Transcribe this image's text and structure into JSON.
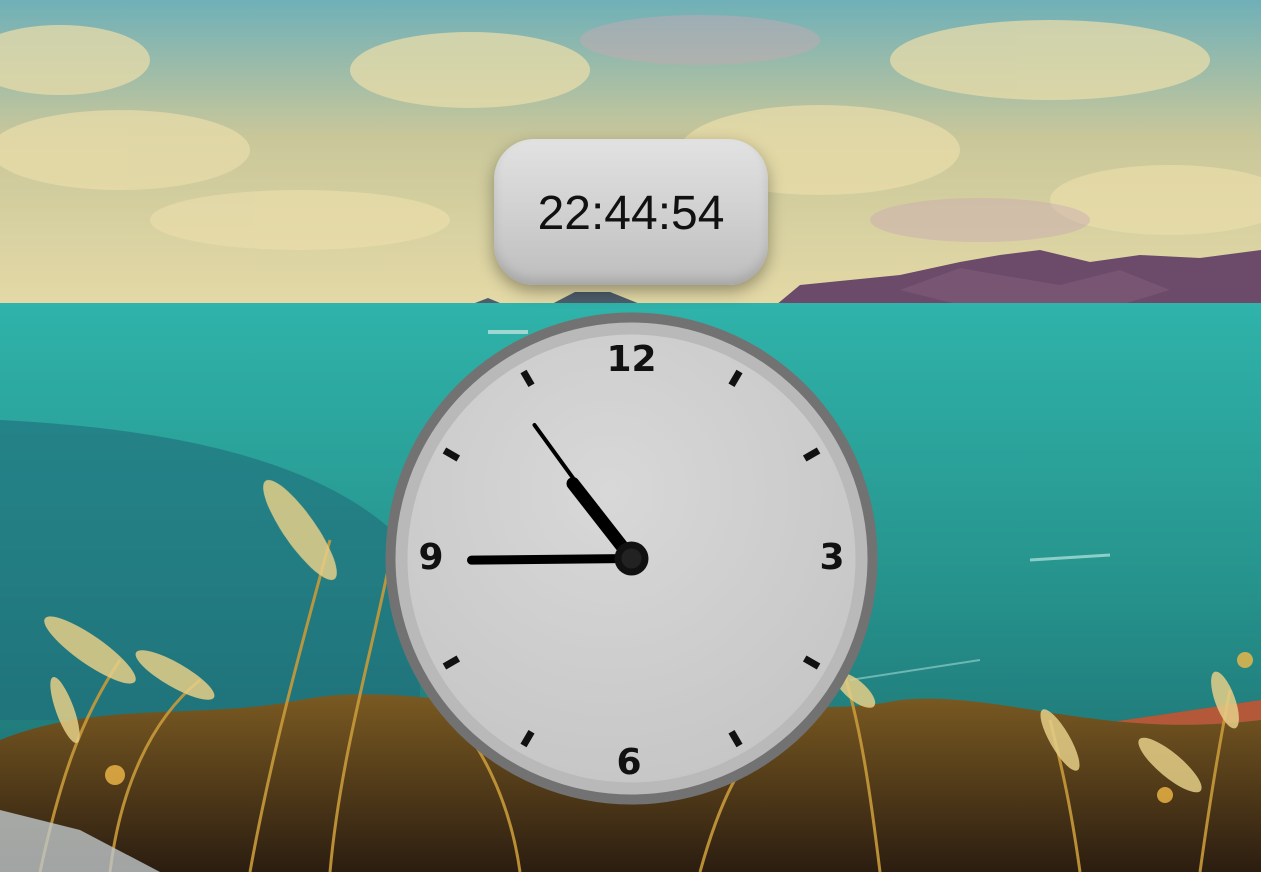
{
  "digital_clock": {
    "time": "22:44:54"
  },
  "analog_clock": {
    "numerals": {
      "top": "12",
      "right": "3",
      "bottom": "6",
      "left": "9"
    },
    "hour": 10,
    "minute": 44,
    "second": 54
  },
  "colors": {
    "sea": "#2a9d94",
    "sky": "#9fc4c0",
    "clock_face": "#d0d0d0",
    "clock_rim": "#7a7a7a",
    "hands": "#000000"
  }
}
